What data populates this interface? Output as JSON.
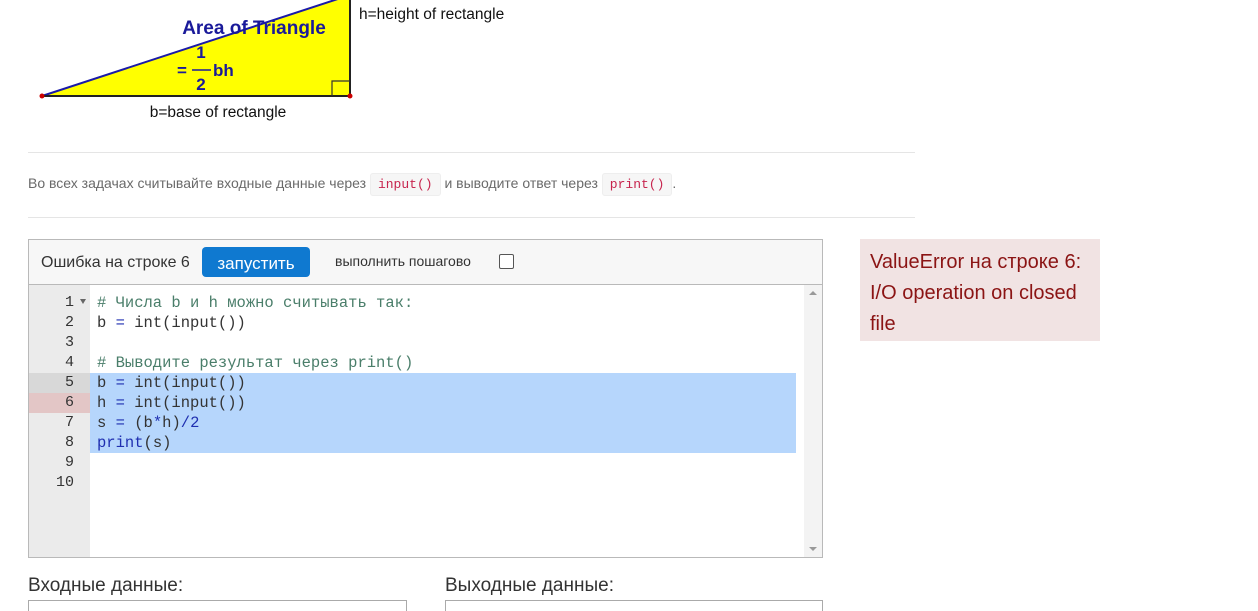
{
  "figure": {
    "title": "Area of Triangle",
    "formula_eq": "=",
    "formula_num": "1",
    "formula_den": "2",
    "formula_tail": "bh",
    "height_label": "h=height of rectangle",
    "base_label": "b=base of rectangle"
  },
  "instructions": {
    "text_before": "Во всех задачах считывайте входные данные через",
    "input_code": "input()",
    "text_middle": "и выводите ответ через",
    "print_code": "print()",
    "text_after": "."
  },
  "editor": {
    "error_label": "Ошибка на строке 6",
    "run_label": "запустить",
    "step_label": "выполнить пошагово",
    "step_checked": false,
    "line_numbers": [
      "1",
      "2",
      "3",
      "4",
      "5",
      "6",
      "7",
      "8",
      "9",
      "10"
    ],
    "code_lines": [
      "# Числа b и h можно считывать так:",
      "b = int(input())",
      "",
      "# Выводите результат через print()",
      "b = int(input())",
      "h = int(input())",
      "s = (b*h)/2",
      "print(s)",
      "",
      ""
    ],
    "selected_lines": [
      5,
      6,
      7,
      8
    ],
    "active_line": 5,
    "error_line": 6,
    "colors": {
      "run_button": "#0f79d0",
      "selection": "#b6d6fc",
      "error_gutter": "#e3c6c6"
    }
  },
  "error_message": "ValueError на строке 6: I/O operation on closed file",
  "io": {
    "input_label": "Входные данные:",
    "output_label": "Выходные данные:"
  }
}
